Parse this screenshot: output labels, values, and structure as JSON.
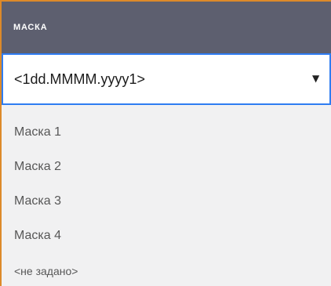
{
  "header": {
    "title": "МАСКА"
  },
  "select": {
    "selected_value": "<1dd.MMMM.yyyy1>",
    "caret_icon": "caret-down-icon"
  },
  "options": [
    "Маска 1",
    "Маска 2",
    "Маска 3",
    "Маска 4",
    "<не задано>"
  ],
  "colors": {
    "header_background": "#5d5f6f",
    "accent_border": "#dd8a2a",
    "focus_border": "#2f7df2",
    "dropdown_background": "#f1f1f2"
  }
}
